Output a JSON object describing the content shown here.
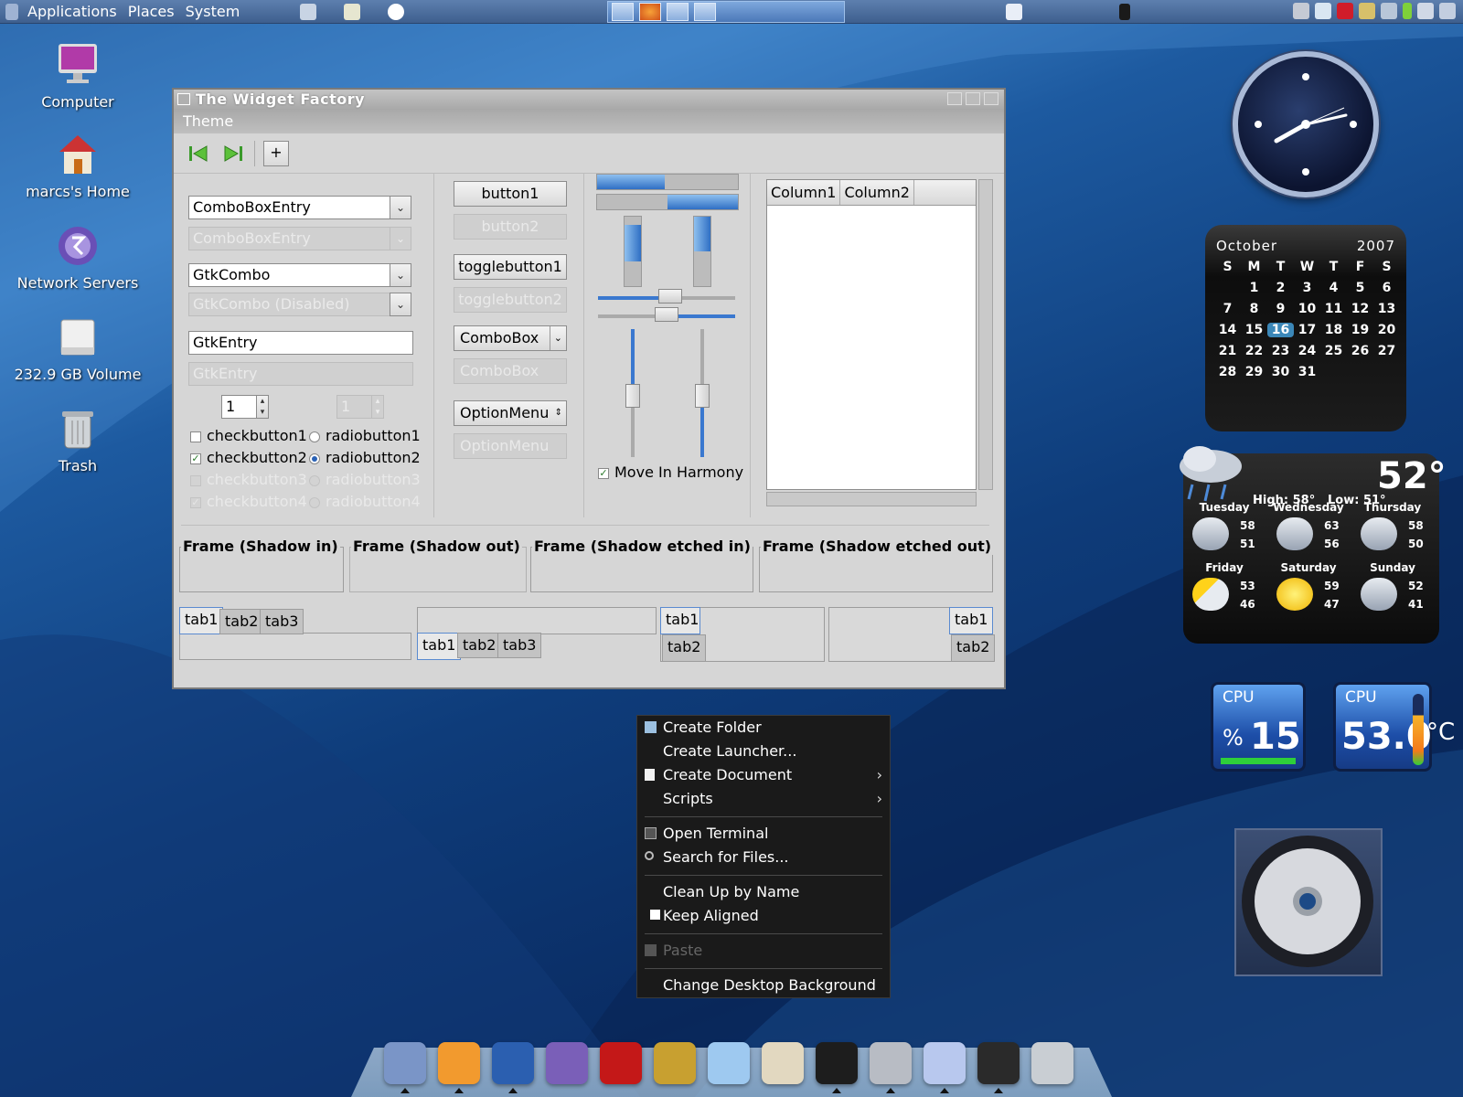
{
  "top_panel": {
    "menus": [
      "Applications",
      "Places",
      "System"
    ]
  },
  "desktop_icons": [
    {
      "label": "Computer",
      "icon": "computer-icon"
    },
    {
      "label": "marcs's Home",
      "icon": "home-folder-icon"
    },
    {
      "label": "Network Servers",
      "icon": "network-icon"
    },
    {
      "label": "232.9 GB Volume",
      "icon": "drive-icon"
    },
    {
      "label": "Trash",
      "icon": "trash-icon"
    }
  ],
  "window": {
    "title": "The Widget Factory",
    "menu": "Theme",
    "col1": {
      "combo_entry": "ComboBoxEntry",
      "combo_entry_disabled": "ComboBoxEntry",
      "gtk_combo": "GtkCombo",
      "gtk_combo_disabled": "GtkCombo (Disabled)",
      "entry": "GtkEntry",
      "entry_disabled": "GtkEntry",
      "spin_value": "1",
      "spin_disabled_value": "1",
      "check1": "checkbutton1",
      "check2": "checkbutton2",
      "check3": "checkbutton3",
      "check4": "checkbutton4",
      "radio1": "radiobutton1",
      "radio2": "radiobutton2",
      "radio3": "radiobutton3",
      "radio4": "radiobutton4"
    },
    "col2": {
      "button1": "button1",
      "button2": "button2",
      "toggle1": "togglebutton1",
      "toggle2": "togglebutton2",
      "combobox": "ComboBox",
      "combobox_disabled": "ComboBox",
      "optionmenu": "OptionMenu",
      "optionmenu_disabled": "OptionMenu"
    },
    "col3": {
      "move_in_harmony": "Move In Harmony"
    },
    "tree": {
      "columns": [
        "Column1",
        "Column2"
      ]
    },
    "frames": [
      "Frame (Shadow in)",
      "Frame (Shadow out)",
      "Frame (Shadow etched in)",
      "Frame (Shadow etched out)"
    ],
    "tabs": [
      "tab1",
      "tab2",
      "tab3"
    ]
  },
  "calendar": {
    "month": "October",
    "year": "2007",
    "weekdays": [
      "S",
      "M",
      "T",
      "W",
      "T",
      "F",
      "S"
    ],
    "days": [
      "",
      "1",
      "2",
      "3",
      "4",
      "5",
      "6",
      "7",
      "8",
      "9",
      "10",
      "11",
      "12",
      "13",
      "14",
      "15",
      "16",
      "17",
      "18",
      "19",
      "20",
      "21",
      "22",
      "23",
      "24",
      "25",
      "26",
      "27",
      "28",
      "29",
      "30",
      "31"
    ],
    "today": "16"
  },
  "weather": {
    "current_temp": "52°",
    "high": "High: 58°",
    "low": "Low: 51°",
    "forecast": [
      {
        "day": "Tuesday",
        "hi": "58",
        "lo": "51"
      },
      {
        "day": "Wednesday",
        "hi": "63",
        "lo": "56"
      },
      {
        "day": "Thursday",
        "hi": "58",
        "lo": "50"
      },
      {
        "day": "Friday",
        "hi": "53",
        "lo": "46"
      },
      {
        "day": "Saturday",
        "hi": "59",
        "lo": "47"
      },
      {
        "day": "Sunday",
        "hi": "52",
        "lo": "41"
      }
    ]
  },
  "cpu_widgets": [
    {
      "label": "CPU",
      "prefix": "%",
      "value": "15"
    },
    {
      "label": "CPU",
      "value": "53.0",
      "unit": "°C"
    }
  ],
  "context_menu": {
    "items": [
      "Create Folder",
      "Create Launcher...",
      "Create Document",
      "Scripts",
      "Open Terminal",
      "Search for Files...",
      "Clean Up by Name",
      "Keep Aligned",
      "Paste",
      "Change Desktop Background"
    ]
  },
  "dock": {
    "icons": [
      "mail-icon",
      "firefox-icon",
      "r-icon",
      "emacs-icon",
      "gnome-foot-icon",
      "tools-icon",
      "itunes-icon",
      "home-icon",
      "terminal-icon",
      "harddisk-icon",
      "window-icon",
      "console-icon",
      "trash-icon"
    ]
  }
}
